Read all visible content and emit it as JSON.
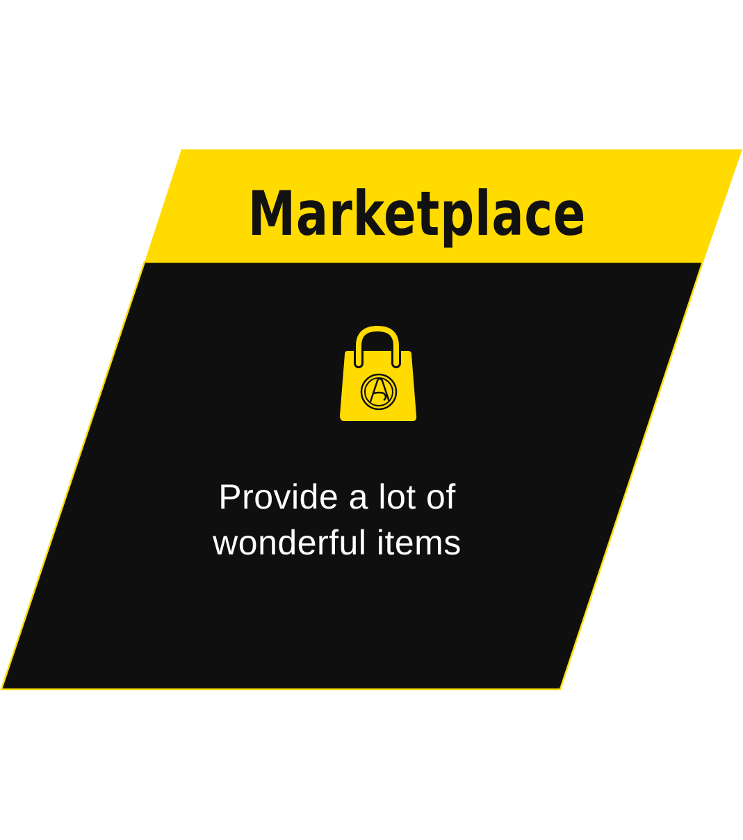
{
  "card": {
    "title": "Marketplace",
    "icon": "shopping-bag-icon",
    "description": "Provide a lot of wonderful items"
  },
  "colors": {
    "accent": "#FFDB00",
    "panel": "#0F0F0F",
    "title_text": "#111111",
    "body_text": "#FFFFFF"
  }
}
